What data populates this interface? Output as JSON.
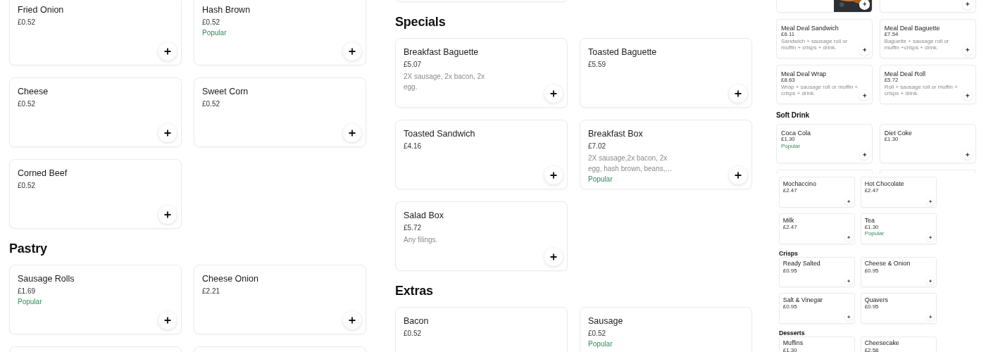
{
  "panels": [
    {
      "blocks": [
        {
          "kind": "row",
          "cards": [
            {
              "kind": "item",
              "name": "Fried Onion",
              "price": "£0.52"
            },
            {
              "kind": "item",
              "name": "Hash Brown",
              "price": "£0.52",
              "badge": "Popular"
            }
          ]
        },
        {
          "kind": "row",
          "cards": [
            {
              "kind": "item",
              "name": "Cheese",
              "price": "£0.52"
            },
            {
              "kind": "item",
              "name": "Sweet Corn",
              "price": "£0.52"
            }
          ]
        },
        {
          "kind": "row",
          "cards": [
            {
              "kind": "item",
              "name": "Corned Beef",
              "price": "£0.52"
            }
          ]
        },
        {
          "kind": "heading",
          "text": "Pastry"
        },
        {
          "kind": "row",
          "cards": [
            {
              "kind": "item",
              "name": "Sausage Rolls",
              "price": "£1.69",
              "badge": "Popular"
            },
            {
              "kind": "item",
              "name": "Cheese Onion",
              "price": "£2.21"
            }
          ]
        },
        {
          "kind": "row",
          "cards": [
            {
              "kind": "stub"
            },
            {
              "kind": "stub"
            }
          ]
        }
      ]
    },
    {
      "blocks": [
        {
          "kind": "row",
          "cards": [
            {
              "kind": "stub"
            }
          ]
        },
        {
          "kind": "heading",
          "text": "Specials"
        },
        {
          "kind": "row",
          "cards": [
            {
              "kind": "item",
              "name": "Breakfast Baguette",
              "price": "£5.07",
              "description": "2X sausage, 2x bacon, 2x egg."
            },
            {
              "kind": "item",
              "name": "Toasted Baguette",
              "price": "£5.59"
            }
          ]
        },
        {
          "kind": "row",
          "cards": [
            {
              "kind": "item",
              "name": "Toasted Sandwich",
              "price": "£4.16"
            },
            {
              "kind": "item",
              "name": "Breakfast Box",
              "price": "£7.02",
              "description": "2X sausage,2x bacon, 2x egg, hash brown, beans,…",
              "badge": "Popular"
            }
          ]
        },
        {
          "kind": "row",
          "cards": [
            {
              "kind": "item",
              "name": "Salad Box",
              "price": "£5.72",
              "description": "Any filings."
            }
          ]
        },
        {
          "kind": "heading",
          "text": "Extras"
        },
        {
          "kind": "row",
          "cards": [
            {
              "kind": "item",
              "name": "Bacon",
              "price": "£0.52",
              "button": false
            },
            {
              "kind": "item",
              "name": "Sausage",
              "price": "£0.52",
              "badge": "Popular",
              "button": false
            }
          ]
        }
      ]
    },
    {
      "blocks": [
        {
          "kind": "row",
          "cards": [
            {
              "kind": "picture"
            },
            {
              "kind": "stub-add"
            }
          ]
        },
        {
          "kind": "row",
          "cards": [
            {
              "kind": "item",
              "name": "Meal Deal Sandwich",
              "price": "£6.11",
              "description": "Sandwich + sausage roll or muffin + crisps + drink."
            },
            {
              "kind": "item",
              "name": "Meal Deal Baguette",
              "price": "£7.54",
              "description": "Baguette + sausage roll or muffin +crisps + drink."
            }
          ]
        },
        {
          "kind": "row",
          "cards": [
            {
              "kind": "item",
              "name": "Meal Deal Wrap",
              "price": "£8.63",
              "description": "Wrap + sausage roll or muffin + crisps + drink."
            },
            {
              "kind": "item",
              "name": "Meal Deal Roll",
              "price": "£5.72",
              "description": "Roll + sausage roll or muffin + crisps + drink."
            }
          ]
        },
        {
          "kind": "heading",
          "text": "Soft Drink"
        },
        {
          "kind": "row",
          "cards": [
            {
              "kind": "item",
              "name": "Coca Cola",
              "price": "£1.30",
              "badge": "Popular"
            },
            {
              "kind": "item",
              "name": "Diet Coke",
              "price": "£1.30"
            }
          ]
        },
        {
          "kind": "row",
          "cards": [
            {
              "kind": "stub"
            },
            {
              "kind": "stub"
            }
          ]
        },
        {
          "kind": "overlay",
          "blocks": [
            {
              "kind": "row",
              "cards": [
                {
                  "kind": "item",
                  "name": "Mochaccino",
                  "price": "£2.47"
                },
                {
                  "kind": "item",
                  "name": "Hot Chocolate",
                  "price": "£2.47"
                }
              ]
            },
            {
              "kind": "row",
              "cards": [
                {
                  "kind": "item",
                  "name": "Milk",
                  "price": "£2.47"
                },
                {
                  "kind": "item",
                  "name": "Tea",
                  "price": "£1.30",
                  "badge": "Popular"
                }
              ]
            },
            {
              "kind": "heading",
              "text": "Crisps"
            },
            {
              "kind": "row",
              "cards": [
                {
                  "kind": "item",
                  "name": "Ready Salted",
                  "price": "£0.95"
                },
                {
                  "kind": "item",
                  "name": "Cheese & Onion",
                  "price": "£0.95"
                }
              ]
            },
            {
              "kind": "row",
              "cards": [
                {
                  "kind": "item",
                  "name": "Salt & Vinegar",
                  "price": "£0.95"
                },
                {
                  "kind": "item",
                  "name": "Quavers",
                  "price": "£0.95"
                }
              ]
            },
            {
              "kind": "heading",
              "text": "Desserts"
            },
            {
              "kind": "row",
              "cards": [
                {
                  "kind": "item",
                  "name": "Muffins",
                  "price": "£1.30",
                  "button": false
                },
                {
                  "kind": "item",
                  "name": "Cheesecake",
                  "price": "£2.58",
                  "button": false
                }
              ]
            }
          ]
        }
      ]
    }
  ]
}
